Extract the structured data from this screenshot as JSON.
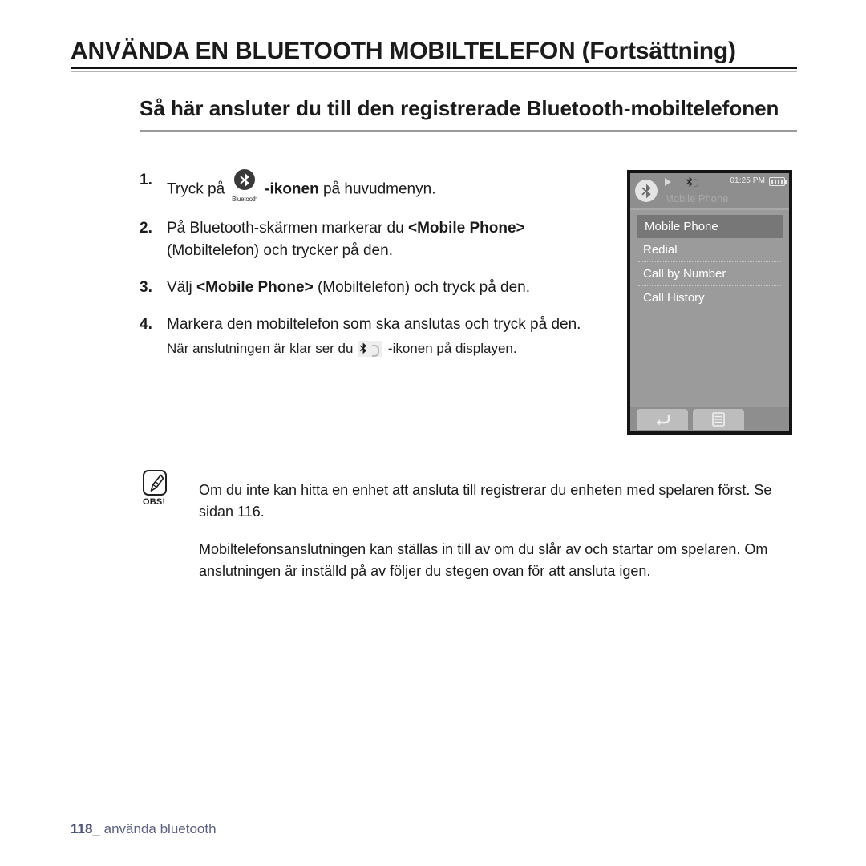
{
  "header": {
    "title": "ANVÄNDA EN BLUETOOTH MOBILTELEFON (Fortsättning)"
  },
  "subtitle": {
    "text": "Så här ansluter du till den registrerade Bluetooth-mobiltelefonen"
  },
  "steps": [
    {
      "number": "1.",
      "pre": "Tryck på",
      "icon_name": "bluetooth-icon",
      "icon_caption": "Bluetooth",
      "bold": "-ikonen",
      "post": " på huvudmenyn."
    },
    {
      "number": "2.",
      "pre": "På Bluetooth-skärmen markerar du ",
      "bold": "<Mobile Phone>",
      "post": " (Mobiltelefon) och trycker på den."
    },
    {
      "number": "3.",
      "pre": "Välj ",
      "bold": "<Mobile Phone>",
      "post": " (Mobiltelefon) och tryck på den."
    },
    {
      "number": "4.",
      "pre": "Markera den mobiltelefon som ska anslutas och tryck på den.",
      "bold": "",
      "post": ""
    }
  ],
  "substep": {
    "pre": "När anslutningen är klar ser du ",
    "icon_name": "bluetooth-connected-icon",
    "post": " -ikonen på displayen."
  },
  "device": {
    "statusbar": {
      "play_icon": "play-icon",
      "bluetooth_icon": "bluetooth-connected-status-icon",
      "time": "01:25 PM",
      "battery_icon": "battery-full-icon"
    },
    "screen_title": "Mobile Phone",
    "badge_icon": "bluetooth-badge-icon",
    "menu_items": [
      {
        "label": "Mobile Phone",
        "selected": true
      },
      {
        "label": "Redial",
        "selected": false
      },
      {
        "label": "Call by Number",
        "selected": false
      },
      {
        "label": "Call History",
        "selected": false
      }
    ],
    "buttons": [
      {
        "icon": "back-arrow-icon"
      },
      {
        "icon": "menu-list-icon"
      }
    ]
  },
  "note": {
    "icon_name": "note-pen-icon",
    "icon_label": "OBS!",
    "paragraphs": [
      "Om du inte kan hitta en enhet att ansluta till registrerar du enheten med spelaren först. Se sidan 116.",
      "Mobiltelefonsanslutningen kan ställas in till av om du slår av och startar om spelaren. Om anslutningen är inställd på av följer du stegen ovan för att ansluta igen."
    ]
  },
  "footer": {
    "page_number": "118",
    "separator": "_",
    "section": "använda bluetooth"
  },
  "colors": {
    "title_rule": "#121212",
    "title_rule_light": "#b4b4b4",
    "subtitle_rule": "#9a9a9a",
    "device_frame": "#141414",
    "device_screen": "#9b9b9b",
    "device_bar": "#8e8e8e",
    "device_selected": "#777777",
    "footer_text": "#5c6180"
  }
}
